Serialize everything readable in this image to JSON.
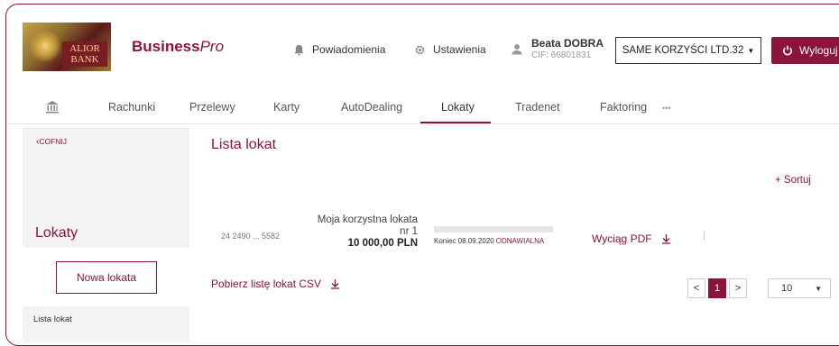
{
  "colors": {
    "accent": "#8a1538",
    "sidebar_bg": "#f3f3f3"
  },
  "header": {
    "logo_text": "ALIOR BANK",
    "brand_bold": "Business",
    "brand_italic": "Pro",
    "notifications_label": "Powiadomienia",
    "settings_label": "Ustawienia",
    "user_name": "Beata DOBRA",
    "user_cif": "CIF: 66801831",
    "company": "SAME KORZYŚCI LTD.32",
    "logout_label": "Wyloguj"
  },
  "nav": {
    "tabs": [
      "Rachunki",
      "Przelewy",
      "Karty",
      "AutoDealing",
      "Lokaty",
      "Tradenet",
      "Faktoring"
    ],
    "more": "•••",
    "active_tab": "Lokaty"
  },
  "sidebar": {
    "back_label": "COFNIJ",
    "title": "Lokaty",
    "new_button": "Nowa lokata",
    "link": "Lista lokat"
  },
  "main": {
    "title": "Lista lokat",
    "sort_label": "+ Sortuj",
    "deposit": {
      "account": "24 2490 ... 5582",
      "name_line1": "Moja korzystna lokata",
      "name_line2": "nr 1",
      "amount": "10 000,00 PLN",
      "end_label": "Koniec 08.09.2020",
      "renewal": "ODNAWIALNA",
      "progress": 0.0
    },
    "pdf_label": "Wyciąg PDF",
    "csv_label": "Pobierz listę lokat CSV"
  },
  "pager": {
    "prev": "<",
    "current": "1",
    "next": ">",
    "per_page": "10"
  }
}
